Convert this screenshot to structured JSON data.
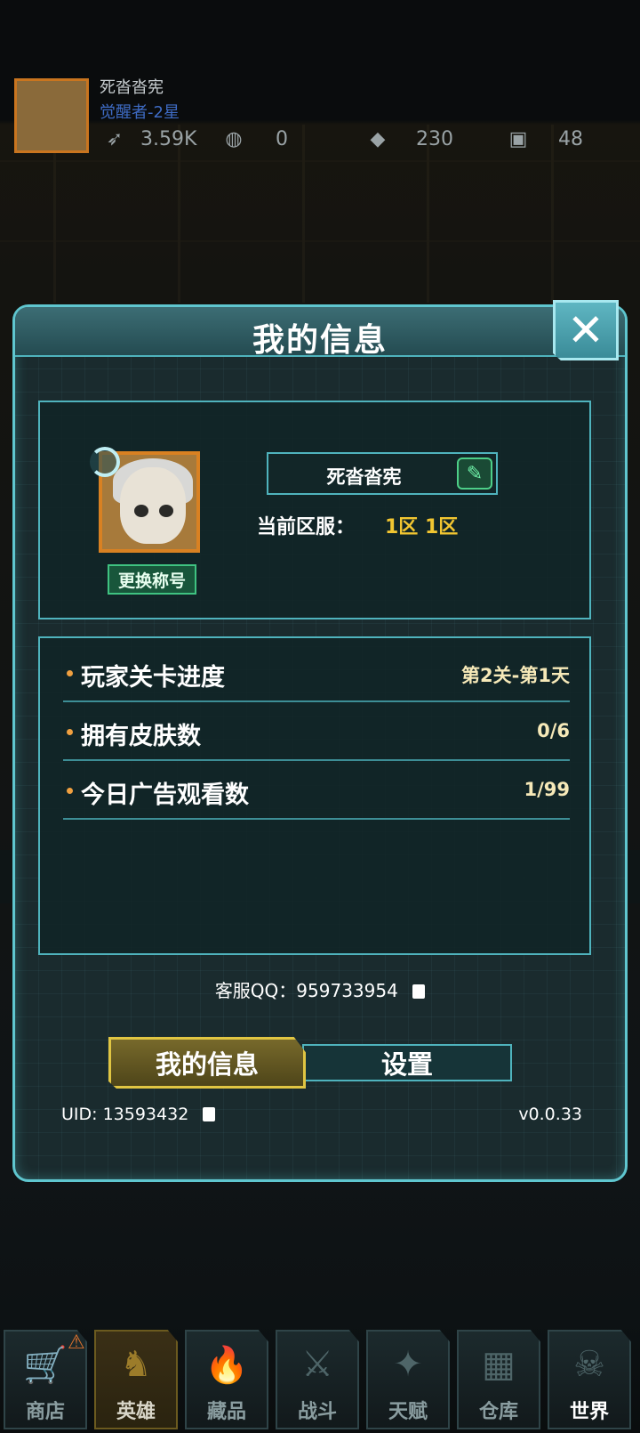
{
  "hud": {
    "player_name": "死沓沓宪",
    "rank": "觉醒者-2星",
    "resources": [
      {
        "icon": "wing-icon",
        "value": "3.59K"
      },
      {
        "icon": "egg-icon",
        "value": "0"
      },
      {
        "icon": "diamond-icon",
        "value": "230"
      },
      {
        "icon": "cash-icon",
        "value": "48"
      }
    ]
  },
  "modal": {
    "title": "我的信息",
    "profile": {
      "change_title_button": "更换称号",
      "name": "死沓沓宪",
      "server_label": "当前区服：",
      "server_value": "1区 1区"
    },
    "stats": [
      {
        "label": "玩家关卡进度",
        "value": "第2关-第1天"
      },
      {
        "label": "拥有皮肤数",
        "value": "0/6"
      },
      {
        "label": "今日广告观看数",
        "value": "1/99"
      }
    ],
    "service_qq": "客服QQ：959733954",
    "tabs": {
      "info": "我的信息",
      "settings": "设置"
    },
    "uid": "UID: 13593432",
    "version": "v0.0.33"
  },
  "nav": [
    {
      "label": "商店",
      "icon": "cart-icon",
      "glyph": "🛒"
    },
    {
      "label": "英雄",
      "icon": "hero-icon",
      "glyph": "♞"
    },
    {
      "label": "藏品",
      "icon": "flame-icon",
      "glyph": "🔥"
    },
    {
      "label": "战斗",
      "icon": "rifle-icon",
      "glyph": "⚔"
    },
    {
      "label": "天赋",
      "icon": "dna-icon",
      "glyph": "✦"
    },
    {
      "label": "仓库",
      "icon": "crate-icon",
      "glyph": "▦"
    },
    {
      "label": "世界",
      "icon": "skull-icon",
      "glyph": "☠"
    }
  ],
  "colors": {
    "accent": "#5fc6cf",
    "gold": "#f2c631",
    "active_tab": "#e0c542"
  }
}
